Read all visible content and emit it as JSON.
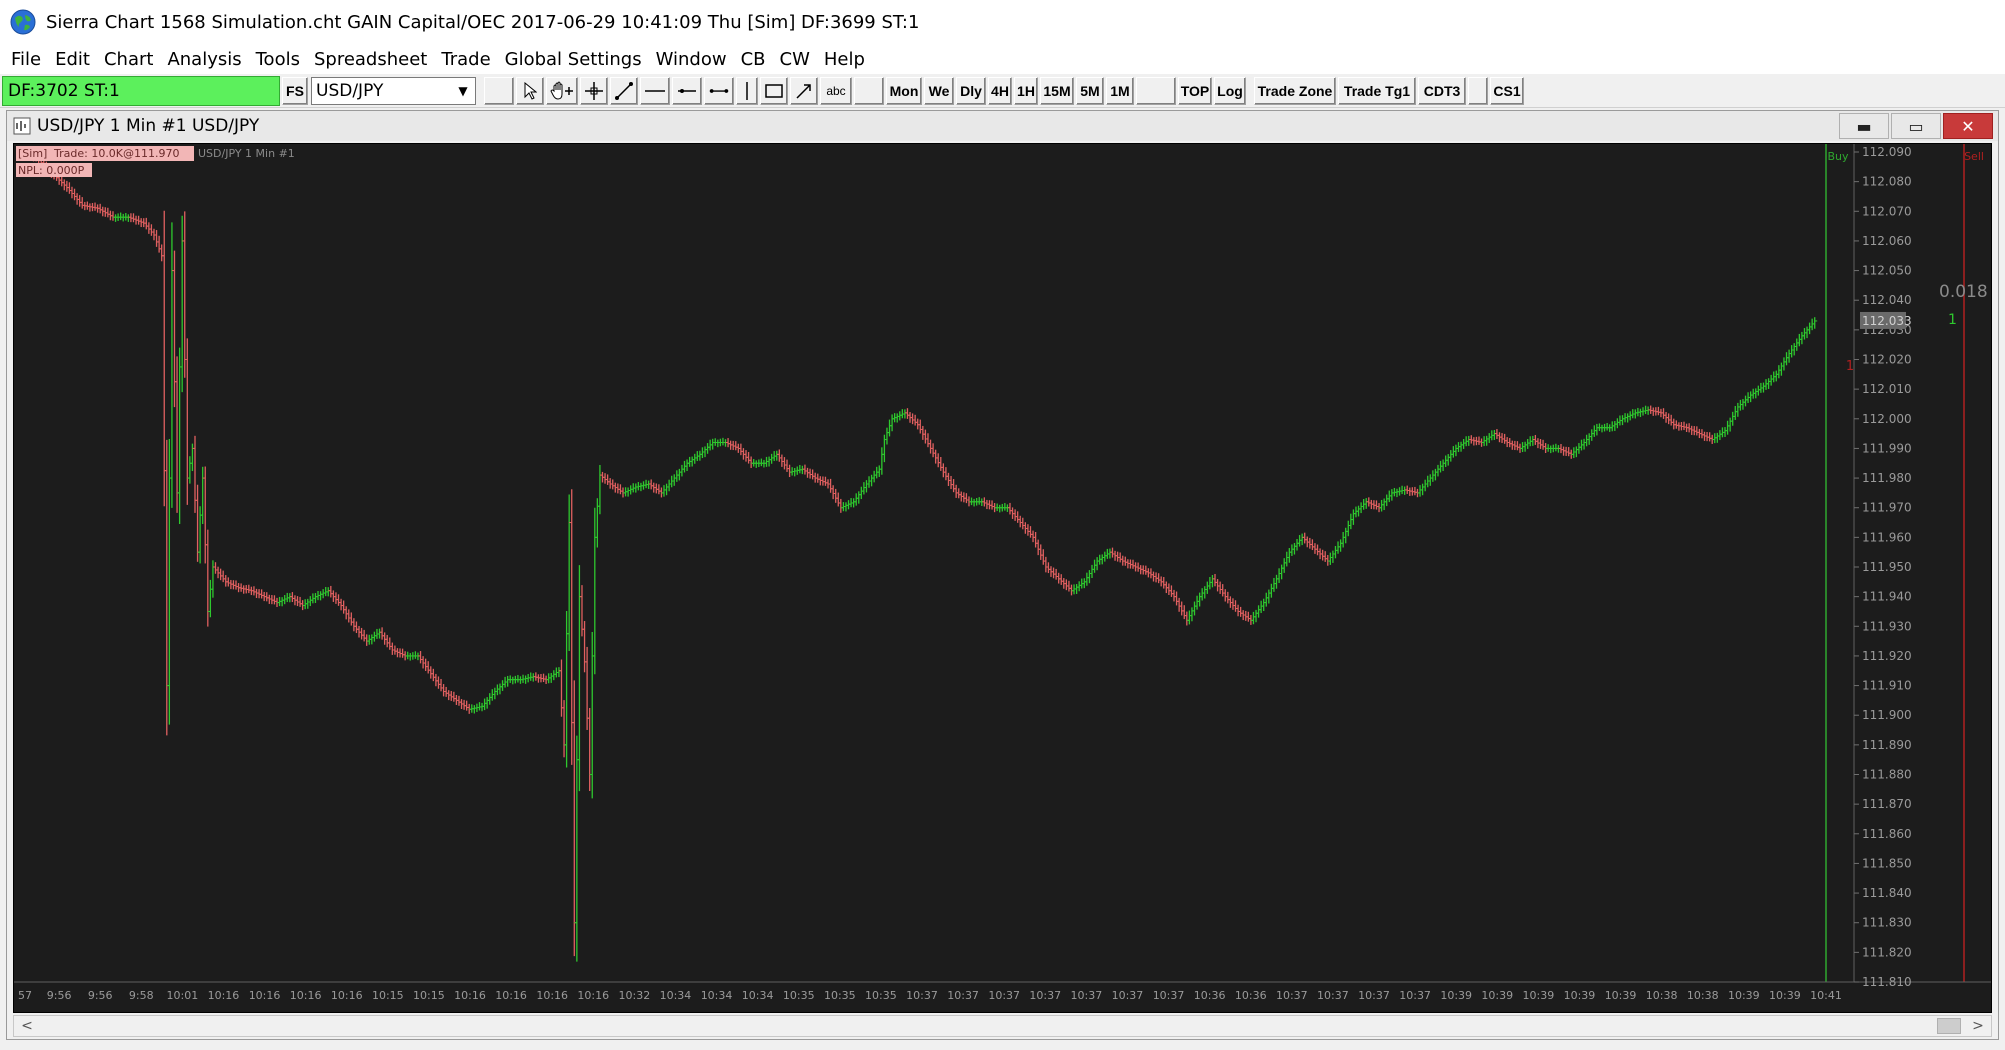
{
  "window": {
    "title": "Sierra Chart 1568 Simulation.cht  GAIN Capital/OEC 2017-06-29  10:41:09 Thu [Sim]  DF:3699  ST:1"
  },
  "menu": [
    "File",
    "Edit",
    "Chart",
    "Analysis",
    "Tools",
    "Spreadsheet",
    "Trade",
    "Global Settings",
    "Window",
    "CB",
    "CW",
    "Help"
  ],
  "toolbar": {
    "df_status": "DF:3702  ST:1",
    "fs_label": "FS",
    "symbol": "USD/JPY",
    "abc_label": "abc",
    "buttons": [
      "Mon",
      "We",
      "Dly",
      "4H",
      "1H",
      "15M",
      "5M",
      "1M",
      "TOP",
      "Log",
      "Trade Zone",
      "Trade Tg1",
      "CDT3",
      "CS1"
    ]
  },
  "chart_window": {
    "title": "USD/JPY  1 Min   #1  USD/JPY",
    "minimize": "▬",
    "maximize": "▭",
    "close": "✕"
  },
  "chart_data": {
    "type": "bar",
    "chart_type": "OHLC bars",
    "symbol": "USD/JPY",
    "interval": "1 Min",
    "overlay_line1_sim": "[Sim]",
    "overlay_line1_trade": "Trade: 10.0K@111.970",
    "overlay_line1_rest": "USD/JPY  1 Min   #1",
    "overlay_line2": "NPL: 0.000P",
    "buy_label": "Buy",
    "sell_label": "Sell",
    "buy_qty": "1",
    "sell_qty_value": "0.018",
    "sell_qty": "1",
    "current_price": "112.033",
    "colors": {
      "background": "#1c1c1c",
      "up_bar": "#2ec82e",
      "down_bar": "#e06060",
      "axis_text": "#9a9a9a",
      "buy_line": "#2fa82f",
      "sell_line": "#b02020"
    },
    "ylim": [
      111.81,
      112.09
    ],
    "y_ticks": [
      "112.090",
      "112.080",
      "112.070",
      "112.060",
      "112.050",
      "112.040",
      "112.030",
      "112.020",
      "112.010",
      "112.000",
      "111.990",
      "111.980",
      "111.970",
      "111.960",
      "111.950",
      "111.940",
      "111.930",
      "111.920",
      "111.910",
      "111.900",
      "111.890",
      "111.880",
      "111.870",
      "111.860",
      "111.850",
      "111.840",
      "111.830",
      "111.820",
      "111.810"
    ],
    "x_ticks": [
      "57",
      "9:56",
      "9:56",
      "9:58",
      "10:01",
      "10:16",
      "10:16",
      "10:16",
      "10:16",
      "10:15",
      "10:15",
      "10:16",
      "10:16",
      "10:16",
      "10:16",
      "10:32",
      "10:34",
      "10:34",
      "10:34",
      "10:35",
      "10:35",
      "10:35",
      "10:37",
      "10:37",
      "10:37",
      "10:37",
      "10:37",
      "10:37",
      "10:37",
      "10:36",
      "10:36",
      "10:37",
      "10:37",
      "10:37",
      "10:37",
      "10:39",
      "10:39",
      "10:39",
      "10:39",
      "10:39",
      "10:38",
      "10:38",
      "10:39",
      "10:39",
      "10:41"
    ],
    "price_path": [
      [
        0,
        112.09
      ],
      [
        6,
        112.088
      ],
      [
        12,
        112.083
      ],
      [
        18,
        112.078
      ],
      [
        24,
        112.072
      ],
      [
        30,
        112.071
      ],
      [
        36,
        112.068
      ],
      [
        42,
        112.068
      ],
      [
        48,
        112.066
      ],
      [
        52,
        112.062
      ],
      [
        55,
        112.055
      ],
      [
        57,
        111.91
      ],
      [
        59,
        112.05
      ],
      [
        61,
        111.975
      ],
      [
        63,
        112.06
      ],
      [
        65,
        111.98
      ],
      [
        67,
        111.99
      ],
      [
        69,
        111.955
      ],
      [
        71,
        111.98
      ],
      [
        73,
        111.935
      ],
      [
        75,
        111.95
      ],
      [
        80,
        111.945
      ],
      [
        85,
        111.943
      ],
      [
        90,
        111.942
      ],
      [
        95,
        111.94
      ],
      [
        100,
        111.938
      ],
      [
        105,
        111.94
      ],
      [
        110,
        111.937
      ],
      [
        115,
        111.94
      ],
      [
        120,
        111.942
      ],
      [
        125,
        111.937
      ],
      [
        130,
        111.93
      ],
      [
        135,
        111.925
      ],
      [
        140,
        111.928
      ],
      [
        145,
        111.922
      ],
      [
        150,
        111.92
      ],
      [
        155,
        111.92
      ],
      [
        160,
        111.914
      ],
      [
        165,
        111.908
      ],
      [
        170,
        111.905
      ],
      [
        175,
        111.902
      ],
      [
        180,
        111.903
      ],
      [
        185,
        111.908
      ],
      [
        190,
        111.912
      ],
      [
        195,
        111.912
      ],
      [
        200,
        111.913
      ],
      [
        205,
        111.912
      ],
      [
        210,
        111.915
      ],
      [
        212,
        111.89
      ],
      [
        214,
        111.965
      ],
      [
        216,
        111.83
      ],
      [
        218,
        111.94
      ],
      [
        220,
        111.918
      ],
      [
        222,
        111.88
      ],
      [
        224,
        111.96
      ],
      [
        226,
        111.981
      ],
      [
        230,
        111.978
      ],
      [
        235,
        111.975
      ],
      [
        240,
        111.977
      ],
      [
        245,
        111.978
      ],
      [
        250,
        111.975
      ],
      [
        255,
        111.98
      ],
      [
        260,
        111.985
      ],
      [
        265,
        111.988
      ],
      [
        270,
        111.992
      ],
      [
        275,
        111.992
      ],
      [
        280,
        111.99
      ],
      [
        285,
        111.985
      ],
      [
        290,
        111.985
      ],
      [
        295,
        111.988
      ],
      [
        300,
        111.982
      ],
      [
        305,
        111.983
      ],
      [
        310,
        111.98
      ],
      [
        315,
        111.978
      ],
      [
        320,
        111.97
      ],
      [
        325,
        111.972
      ],
      [
        330,
        111.978
      ],
      [
        335,
        111.983
      ],
      [
        337,
        111.993
      ],
      [
        340,
        112.0
      ],
      [
        345,
        112.002
      ],
      [
        350,
        111.998
      ],
      [
        355,
        111.99
      ],
      [
        360,
        111.982
      ],
      [
        365,
        111.975
      ],
      [
        370,
        111.972
      ],
      [
        375,
        111.972
      ],
      [
        380,
        111.97
      ],
      [
        385,
        111.97
      ],
      [
        390,
        111.965
      ],
      [
        395,
        111.96
      ],
      [
        400,
        111.95
      ],
      [
        405,
        111.946
      ],
      [
        410,
        111.942
      ],
      [
        415,
        111.945
      ],
      [
        420,
        111.952
      ],
      [
        425,
        111.955
      ],
      [
        430,
        111.952
      ],
      [
        435,
        111.95
      ],
      [
        440,
        111.948
      ],
      [
        445,
        111.945
      ],
      [
        450,
        111.94
      ],
      [
        455,
        111.932
      ],
      [
        460,
        111.94
      ],
      [
        465,
        111.946
      ],
      [
        470,
        111.94
      ],
      [
        475,
        111.935
      ],
      [
        480,
        111.932
      ],
      [
        485,
        111.938
      ],
      [
        490,
        111.946
      ],
      [
        495,
        111.955
      ],
      [
        500,
        111.96
      ],
      [
        505,
        111.956
      ],
      [
        510,
        111.952
      ],
      [
        515,
        111.958
      ],
      [
        520,
        111.968
      ],
      [
        525,
        111.972
      ],
      [
        530,
        111.97
      ],
      [
        535,
        111.975
      ],
      [
        540,
        111.976
      ],
      [
        545,
        111.975
      ],
      [
        550,
        111.98
      ],
      [
        555,
        111.985
      ],
      [
        560,
        111.99
      ],
      [
        565,
        111.993
      ],
      [
        570,
        111.992
      ],
      [
        575,
        111.995
      ],
      [
        580,
        111.992
      ],
      [
        585,
        111.99
      ],
      [
        590,
        111.993
      ],
      [
        595,
        111.99
      ],
      [
        600,
        111.99
      ],
      [
        605,
        111.988
      ],
      [
        610,
        111.992
      ],
      [
        615,
        111.997
      ],
      [
        620,
        111.997
      ],
      [
        625,
        112.0
      ],
      [
        630,
        112.002
      ],
      [
        635,
        112.003
      ],
      [
        640,
        112.002
      ],
      [
        645,
        111.998
      ],
      [
        650,
        111.997
      ],
      [
        655,
        111.995
      ],
      [
        660,
        111.993
      ],
      [
        665,
        111.996
      ],
      [
        670,
        112.004
      ],
      [
        675,
        112.008
      ],
      [
        680,
        112.011
      ],
      [
        685,
        112.015
      ],
      [
        690,
        112.022
      ],
      [
        695,
        112.028
      ],
      [
        700,
        112.033
      ]
    ]
  }
}
